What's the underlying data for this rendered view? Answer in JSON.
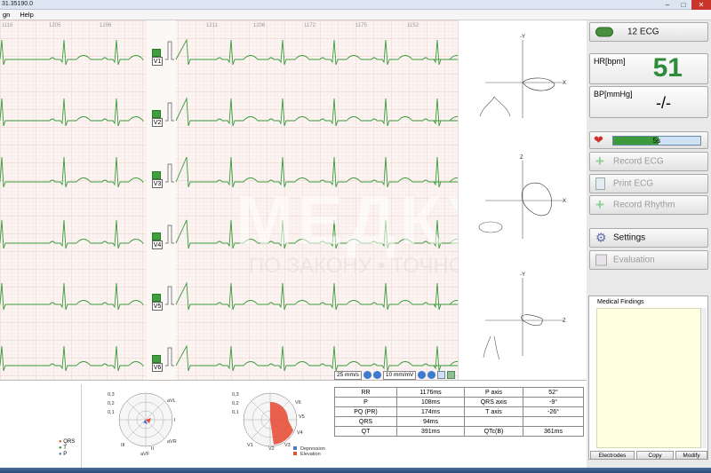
{
  "window": {
    "title": "31.35190.0",
    "min": "–",
    "max": "□",
    "close": "✕"
  },
  "menu": [
    {
      "label": "gn"
    },
    {
      "label": "Help"
    }
  ],
  "ecg": {
    "leads": [
      "V1",
      "V2",
      "V3",
      "V4",
      "V5",
      "V6"
    ],
    "top_numbers": [
      "1116",
      "1205",
      "1206",
      "1211",
      "1206",
      "1172",
      "1175",
      "1152"
    ],
    "speed": "25 mm/s",
    "gain": "10 mm/mV"
  },
  "vectors": {
    "frontal": {
      "axis_top": "-Y",
      "axis_right": "X"
    },
    "transverse": {
      "axis_top": "Z",
      "axis_right": "X"
    },
    "sagittal": {
      "axis_top": "-Y",
      "axis_right": "Z"
    }
  },
  "right_panel": {
    "ecg_button": "12 ECG",
    "hr_label": "HR[bpm]",
    "hr_value": "51",
    "bp_label": "BP[mmHg]",
    "bp_value": "-/-",
    "progress_label": "5s",
    "progress_fraction": 0.52,
    "record_ecg": "Record ECG",
    "print_ecg": "Print ECG",
    "record_rhythm": "Record Rhythm",
    "settings": "Settings",
    "evaluation": "Evaluation",
    "findings_title": "Medical Findings",
    "electrodes": "Electrodes",
    "copy": "Copy",
    "modify": "Modify"
  },
  "legend": {
    "qrs": "QRS",
    "t": "T",
    "p": "P",
    "depression": "Depression",
    "elevation": "Elevation"
  },
  "polar1": {
    "rings": [
      "0,3",
      "0,2",
      "0,1"
    ],
    "labels": [
      "aVL",
      "I",
      "aVR",
      "aVF",
      "II",
      "III"
    ]
  },
  "polar2": {
    "rings": [
      "0,3",
      "0,2",
      "0,1"
    ],
    "labels": [
      "V5",
      "V6",
      "V4",
      "V3",
      "V2",
      "V1"
    ]
  },
  "intervals": [
    {
      "name": "RR",
      "value": "1176ms"
    },
    {
      "name": "P",
      "value": "108ms"
    },
    {
      "name": "PQ (PR)",
      "value": "174ms"
    },
    {
      "name": "QRS",
      "value": "94ms"
    },
    {
      "name": "QT",
      "value": "391ms"
    }
  ],
  "axes": [
    {
      "name": "P axis",
      "value": "52°"
    },
    {
      "name": "QRS axis",
      "value": "-9°"
    },
    {
      "name": "T axis",
      "value": "-26°"
    },
    {
      "name": "",
      "value": ""
    },
    {
      "name": "QTc(B)",
      "value": "361ms"
    }
  ],
  "watermark": {
    "brand": "МЕДКУП",
    "slogan": "ПО ЗАКОНУ • ТОЧНО В СРОК"
  },
  "colors": {
    "ecg_trace": "#3a9a3a",
    "hr_green": "#2e8b3a",
    "grid": "#efd5d0",
    "elevation": "#e8503a",
    "depression": "#4a7ac8"
  }
}
